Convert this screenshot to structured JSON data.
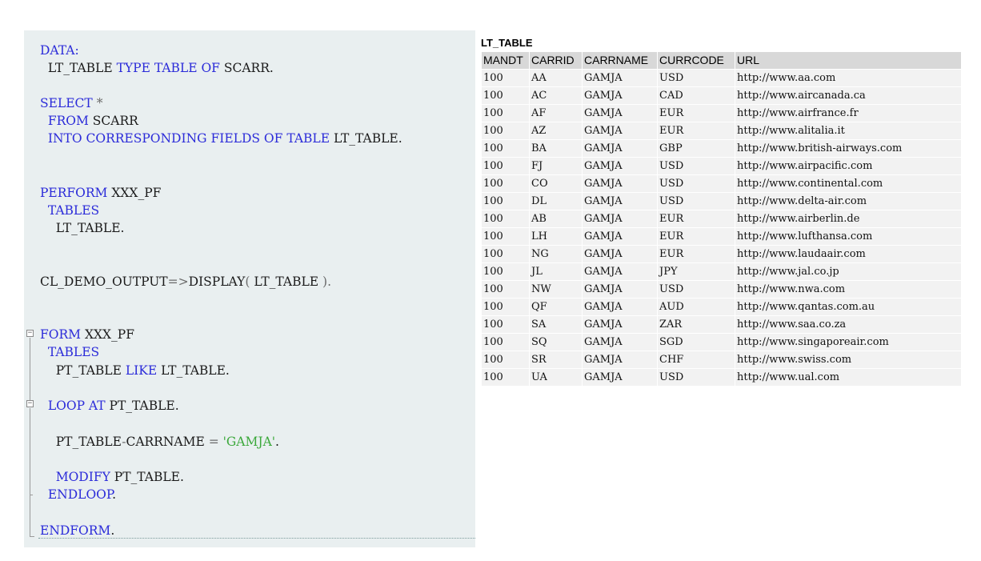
{
  "code": {
    "lines": [
      {
        "parts": [
          {
            "t": "DATA:",
            "c": "kw"
          }
        ]
      },
      {
        "parts": [
          {
            "t": "  LT_TABLE "
          },
          {
            "t": "TYPE TABLE OF",
            "c": "kw"
          },
          {
            "t": " SCARR."
          }
        ]
      },
      {
        "parts": []
      },
      {
        "parts": [
          {
            "t": "SELECT",
            "c": "kw"
          },
          {
            "t": " "
          },
          {
            "t": "*",
            "c": "op"
          }
        ]
      },
      {
        "parts": [
          {
            "t": "  "
          },
          {
            "t": "FROM",
            "c": "kw"
          },
          {
            "t": " SCARR"
          }
        ]
      },
      {
        "parts": [
          {
            "t": "  "
          },
          {
            "t": "INTO CORRESPONDING FIELDS OF TABLE",
            "c": "kw"
          },
          {
            "t": " LT_TABLE."
          }
        ]
      },
      {
        "parts": []
      },
      {
        "parts": []
      },
      {
        "parts": [
          {
            "t": "PERFORM",
            "c": "kw"
          },
          {
            "t": " XXX_PF"
          }
        ]
      },
      {
        "parts": [
          {
            "t": "  "
          },
          {
            "t": "TABLES",
            "c": "kw"
          }
        ]
      },
      {
        "parts": [
          {
            "t": "    LT_TABLE."
          }
        ]
      },
      {
        "parts": []
      },
      {
        "parts": []
      },
      {
        "parts": [
          {
            "t": "CL_DEMO_OUTPUT"
          },
          {
            "t": "=>",
            "c": "op"
          },
          {
            "t": "DISPLAY"
          },
          {
            "t": "( ",
            "c": "op"
          },
          {
            "t": "LT_TABLE "
          },
          {
            "t": ").",
            "c": "op"
          }
        ]
      },
      {
        "parts": []
      },
      {
        "parts": []
      },
      {
        "parts": [
          {
            "t": "FORM",
            "c": "kw"
          },
          {
            "t": " XXX_PF"
          }
        ]
      },
      {
        "parts": [
          {
            "t": "  "
          },
          {
            "t": "TABLES",
            "c": "kw"
          }
        ]
      },
      {
        "parts": [
          {
            "t": "    PT_TABLE "
          },
          {
            "t": "LIKE",
            "c": "kw"
          },
          {
            "t": " LT_TABLE."
          }
        ]
      },
      {
        "parts": []
      },
      {
        "parts": [
          {
            "t": "  "
          },
          {
            "t": "LOOP AT",
            "c": "kw"
          },
          {
            "t": " PT_TABLE."
          }
        ]
      },
      {
        "parts": []
      },
      {
        "parts": [
          {
            "t": "    PT_TABLE"
          },
          {
            "t": "-",
            "c": "op"
          },
          {
            "t": "CARRNAME "
          },
          {
            "t": "=",
            "c": "op"
          },
          {
            "t": " "
          },
          {
            "t": "'GAMJA'",
            "c": "str"
          },
          {
            "t": "."
          }
        ]
      },
      {
        "parts": []
      },
      {
        "parts": [
          {
            "t": "    "
          },
          {
            "t": "MODIFY",
            "c": "kw"
          },
          {
            "t": " PT_TABLE."
          }
        ]
      },
      {
        "parts": [
          {
            "t": "  "
          },
          {
            "t": "ENDLOOP",
            "c": "kw"
          },
          {
            "t": "."
          }
        ]
      },
      {
        "parts": []
      },
      {
        "parts": [
          {
            "t": "ENDFORM",
            "c": "kw"
          },
          {
            "t": "."
          }
        ]
      }
    ]
  },
  "output": {
    "title": "LT_TABLE",
    "columns": [
      "MANDT",
      "CARRID",
      "CARRNAME",
      "CURRCODE",
      "URL"
    ],
    "rows": [
      [
        "100",
        "AA",
        "GAMJA",
        "USD",
        "http://www.aa.com"
      ],
      [
        "100",
        "AC",
        "GAMJA",
        "CAD",
        "http://www.aircanada.ca"
      ],
      [
        "100",
        "AF",
        "GAMJA",
        "EUR",
        "http://www.airfrance.fr"
      ],
      [
        "100",
        "AZ",
        "GAMJA",
        "EUR",
        "http://www.alitalia.it"
      ],
      [
        "100",
        "BA",
        "GAMJA",
        "GBP",
        "http://www.british-airways.com"
      ],
      [
        "100",
        "FJ",
        "GAMJA",
        "USD",
        "http://www.airpacific.com"
      ],
      [
        "100",
        "CO",
        "GAMJA",
        "USD",
        "http://www.continental.com"
      ],
      [
        "100",
        "DL",
        "GAMJA",
        "USD",
        "http://www.delta-air.com"
      ],
      [
        "100",
        "AB",
        "GAMJA",
        "EUR",
        "http://www.airberlin.de"
      ],
      [
        "100",
        "LH",
        "GAMJA",
        "EUR",
        "http://www.lufthansa.com"
      ],
      [
        "100",
        "NG",
        "GAMJA",
        "EUR",
        "http://www.laudaair.com"
      ],
      [
        "100",
        "JL",
        "GAMJA",
        "JPY",
        "http://www.jal.co.jp"
      ],
      [
        "100",
        "NW",
        "GAMJA",
        "USD",
        "http://www.nwa.com"
      ],
      [
        "100",
        "QF",
        "GAMJA",
        "AUD",
        "http://www.qantas.com.au"
      ],
      [
        "100",
        "SA",
        "GAMJA",
        "ZAR",
        "http://www.saa.co.za"
      ],
      [
        "100",
        "SQ",
        "GAMJA",
        "SGD",
        "http://www.singaporeair.com"
      ],
      [
        "100",
        "SR",
        "GAMJA",
        "CHF",
        "http://www.swiss.com"
      ],
      [
        "100",
        "UA",
        "GAMJA",
        "USD",
        "http://www.ual.com"
      ]
    ]
  },
  "colors": {
    "keyword": "#2b2bd9",
    "string": "#3aa83a",
    "editor_background": "#e9eff0",
    "header_background": "#d8d8d8",
    "cell_background": "#f2f2f2"
  },
  "icons": [
    "fold-collapse-icon"
  ]
}
